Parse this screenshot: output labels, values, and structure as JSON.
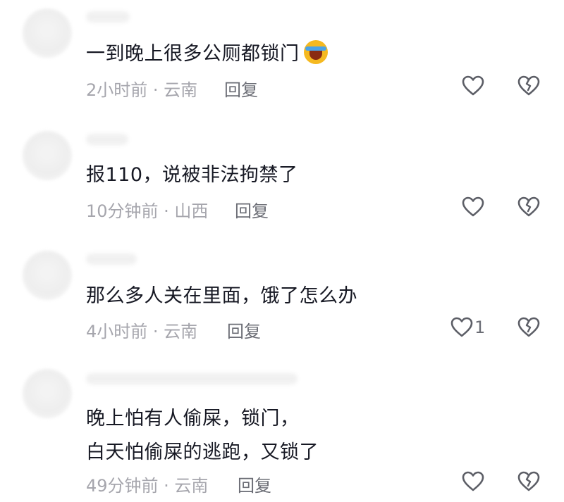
{
  "comments": [
    {
      "lines": [
        "一到晚上很多公厕都锁门"
      ],
      "emoji": "loudly-crying-face",
      "meta": "2小时前 · 云南",
      "reply_label": "回复",
      "like_count": ""
    },
    {
      "lines": [
        "报110，说被非法拘禁了"
      ],
      "meta": "10分钟前 · 山西",
      "reply_label": "回复",
      "like_count": ""
    },
    {
      "lines": [
        "那么多人关在里面，饿了怎么办"
      ],
      "meta": "4小时前 · 云南",
      "reply_label": "回复",
      "like_count": "1"
    },
    {
      "lines": [
        "晚上怕有人偷屎，锁门，",
        "白天怕偷屎的逃跑，又锁了"
      ],
      "meta": "49分钟前 · 云南",
      "reply_label": "回复",
      "like_count": ""
    }
  ],
  "icons": {
    "like": "heart-outline-icon",
    "dislike": "broken-heart-outline-icon"
  },
  "colors": {
    "text": "#161823",
    "meta": "#a6a6ad",
    "reply": "#6b6d75",
    "icon": "#5c5e66"
  }
}
